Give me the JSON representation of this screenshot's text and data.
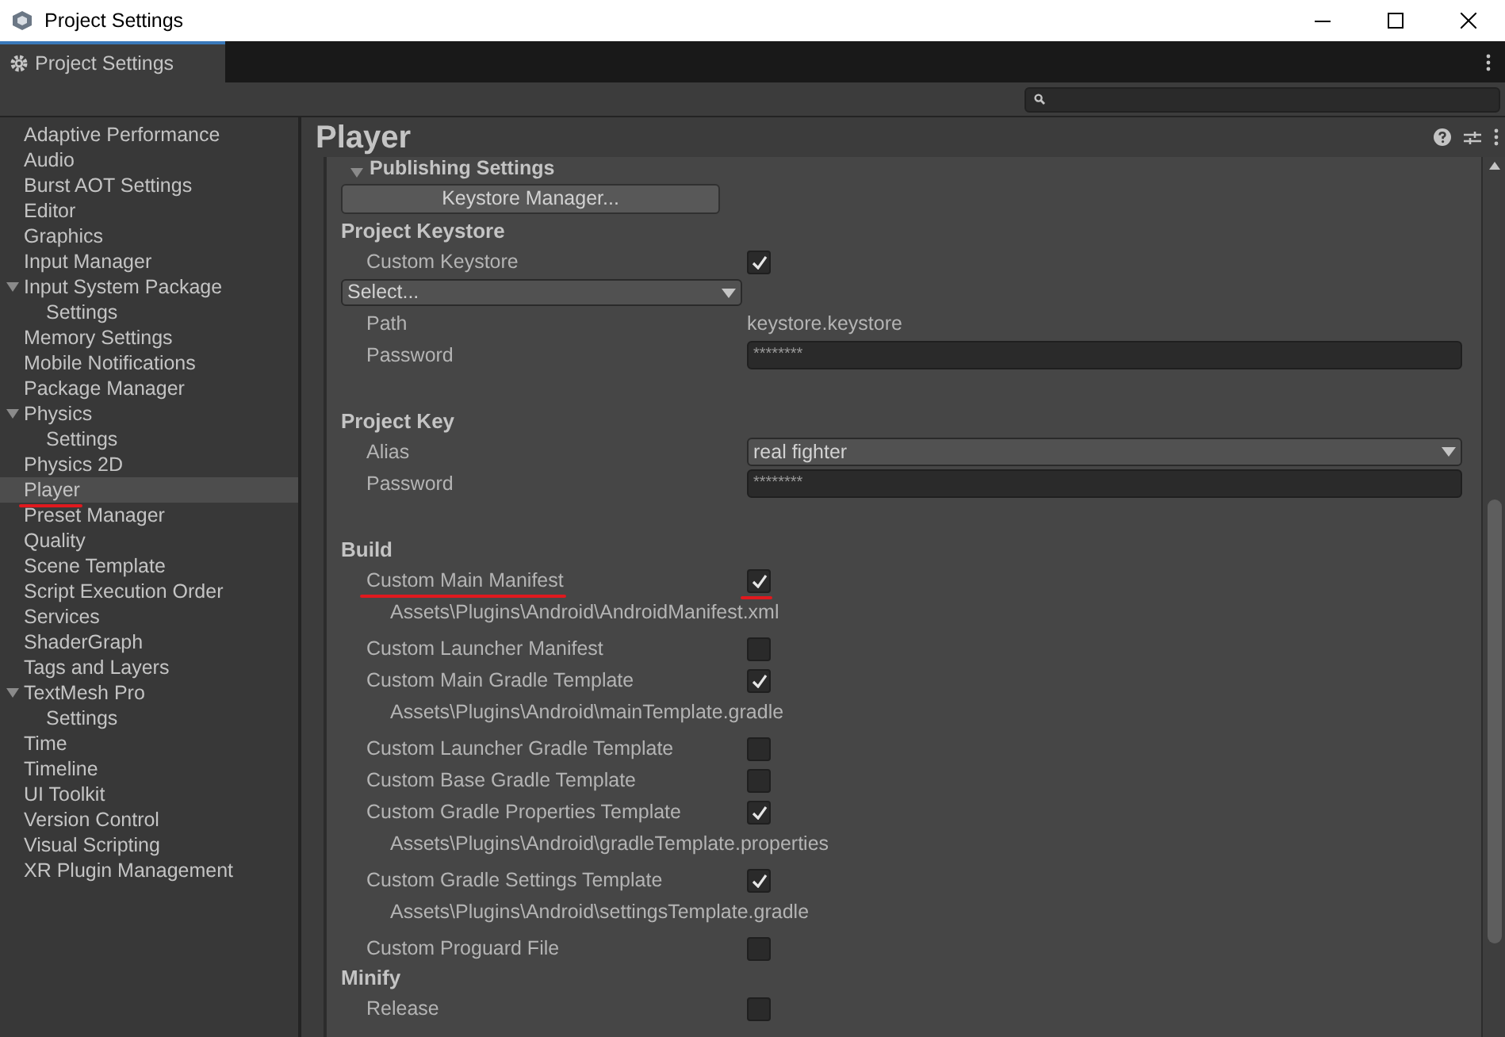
{
  "window": {
    "title": "Project Settings"
  },
  "tab": {
    "label": "Project Settings",
    "selected": true
  },
  "sidebar": {
    "items": [
      {
        "label": "Adaptive Performance",
        "selected": false
      },
      {
        "label": "Audio",
        "selected": false
      },
      {
        "label": "Burst AOT Settings",
        "selected": false
      },
      {
        "label": "Editor",
        "selected": false
      },
      {
        "label": "Graphics",
        "selected": false
      },
      {
        "label": "Input Manager",
        "selected": false
      },
      {
        "label": "Input System Package",
        "selected": false,
        "expanded": true,
        "children": [
          {
            "label": "Settings",
            "selected": false
          }
        ]
      },
      {
        "label": "Memory Settings",
        "selected": false
      },
      {
        "label": "Mobile Notifications",
        "selected": false
      },
      {
        "label": "Package Manager",
        "selected": false
      },
      {
        "label": "Physics",
        "selected": false,
        "expanded": true,
        "children": [
          {
            "label": "Settings",
            "selected": false
          }
        ]
      },
      {
        "label": "Physics 2D",
        "selected": false
      },
      {
        "label": "Player",
        "selected": true,
        "underlined": true
      },
      {
        "label": "Preset Manager",
        "selected": false
      },
      {
        "label": "Quality",
        "selected": false
      },
      {
        "label": "Scene Template",
        "selected": false
      },
      {
        "label": "Script Execution Order",
        "selected": false
      },
      {
        "label": "Services",
        "selected": false
      },
      {
        "label": "ShaderGraph",
        "selected": false
      },
      {
        "label": "Tags and Layers",
        "selected": false
      },
      {
        "label": "TextMesh Pro",
        "selected": false,
        "expanded": true,
        "children": [
          {
            "label": "Settings",
            "selected": false
          }
        ]
      },
      {
        "label": "Time",
        "selected": false
      },
      {
        "label": "Timeline",
        "selected": false
      },
      {
        "label": "UI Toolkit",
        "selected": false
      },
      {
        "label": "Version Control",
        "selected": false
      },
      {
        "label": "Visual Scripting",
        "selected": false
      },
      {
        "label": "XR Plugin Management",
        "selected": false
      }
    ]
  },
  "panel": {
    "title": "Player",
    "rows": [
      {
        "kind": "foldout",
        "label": "Publishing Settings",
        "expanded": true
      },
      {
        "kind": "button",
        "label": "Keystore Manager..."
      },
      {
        "kind": "header",
        "label": "Project Keystore"
      },
      {
        "kind": "checkbox",
        "label": "Custom Keystore",
        "checked": true
      },
      {
        "kind": "select",
        "value": "Select..."
      },
      {
        "kind": "text",
        "label": "Path",
        "value": "keystore.keystore"
      },
      {
        "kind": "password",
        "label": "Password",
        "value": "********"
      },
      {
        "kind": "header",
        "label": "Project Key"
      },
      {
        "kind": "dropdown",
        "label": "Alias",
        "value": "real fighter"
      },
      {
        "kind": "password",
        "label": "Password",
        "value": "********"
      },
      {
        "kind": "header",
        "label": "Build"
      },
      {
        "kind": "checkbox",
        "label": "Custom Main Manifest",
        "checked": true,
        "underlined": true
      },
      {
        "kind": "path",
        "value": "Assets\\Plugins\\Android\\AndroidManifest.xml"
      },
      {
        "kind": "checkbox",
        "label": "Custom Launcher Manifest",
        "checked": false
      },
      {
        "kind": "checkbox",
        "label": "Custom Main Gradle Template",
        "checked": true
      },
      {
        "kind": "path",
        "value": "Assets\\Plugins\\Android\\mainTemplate.gradle"
      },
      {
        "kind": "checkbox",
        "label": "Custom Launcher Gradle Template",
        "checked": false
      },
      {
        "kind": "checkbox",
        "label": "Custom Base Gradle Template",
        "checked": false
      },
      {
        "kind": "checkbox",
        "label": "Custom Gradle Properties Template",
        "checked": true
      },
      {
        "kind": "path",
        "value": "Assets\\Plugins\\Android\\gradleTemplate.properties"
      },
      {
        "kind": "checkbox",
        "label": "Custom Gradle Settings Template",
        "checked": true
      },
      {
        "kind": "path",
        "value": "Assets\\Plugins\\Android\\settingsTemplate.gradle"
      },
      {
        "kind": "checkbox",
        "label": "Custom Proguard File",
        "checked": false
      },
      {
        "kind": "header",
        "label": "Minify"
      },
      {
        "kind": "checkbox",
        "label": "Release",
        "checked": false
      }
    ]
  }
}
